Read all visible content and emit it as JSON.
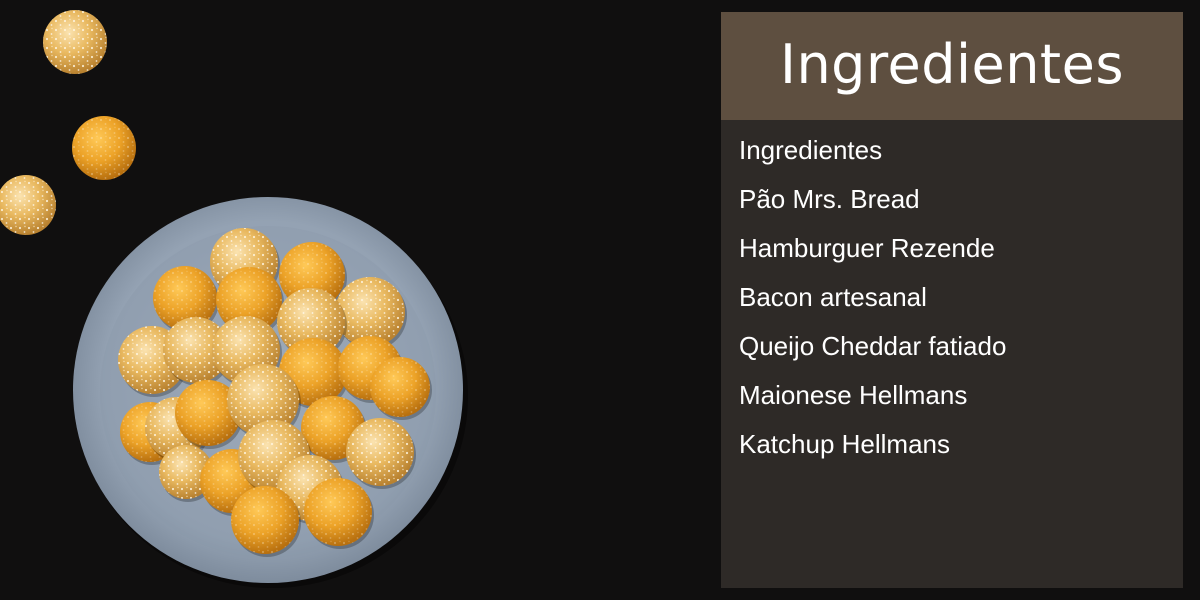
{
  "card": {
    "title": "Ingredientes",
    "items": [
      "Ingredientes",
      "Pão Mrs. Bread",
      "Hamburguer Rezende",
      "Bacon artesanal",
      "Queijo Cheddar fatiado",
      "Maionese Hellmans",
      "Katchup Hellmans"
    ]
  },
  "colors": {
    "page_background": "#100f0f",
    "card_background": "#2e2a27",
    "card_header": "#5e4f40",
    "text": "#ffffff"
  }
}
